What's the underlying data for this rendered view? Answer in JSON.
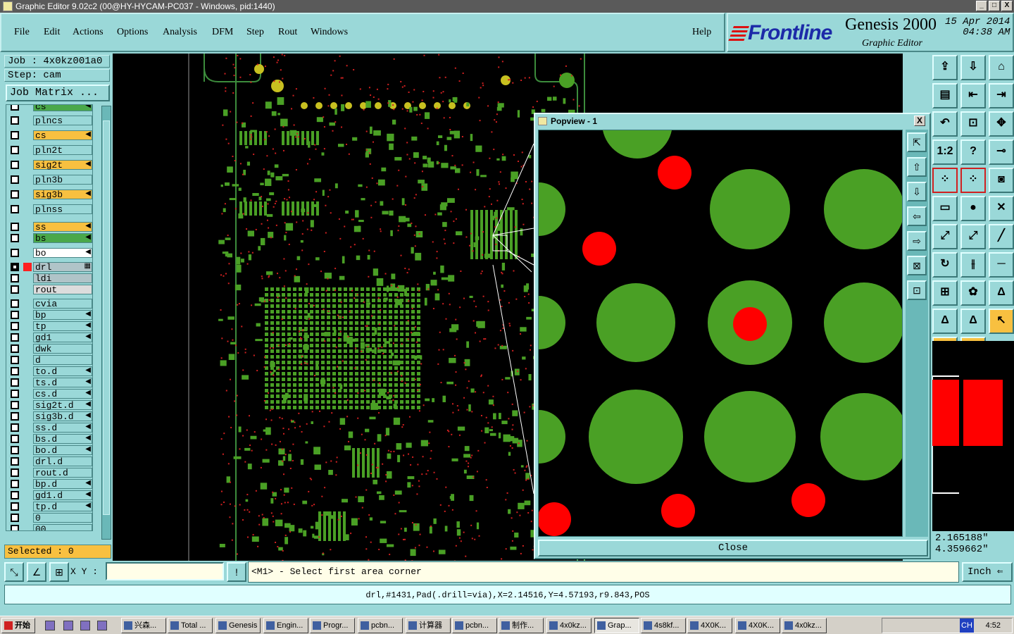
{
  "window": {
    "title": "Graphic Editor 9.02c2 (00@HY-HYCAM-PC037 - Windows, pid:1440)",
    "buttons": [
      "_",
      "□",
      "X"
    ]
  },
  "menu": {
    "items": [
      "File",
      "Edit",
      "Actions",
      "Options",
      "Analysis",
      "DFM",
      "Step",
      "Rout",
      "Windows"
    ],
    "help": "Help"
  },
  "brand": {
    "logo": "Frontline",
    "product": "Genesis 2000",
    "subtitle": "Graphic Editor",
    "date": "15 Apr 2014",
    "time": "04:38 AM"
  },
  "job": {
    "job_label": "Job : 4x0kz001a0",
    "step_label": "Step: cam",
    "matrix_button": "Job Matrix ..."
  },
  "layers": [
    {
      "name": "cs",
      "bg": "#4aa84a",
      "flag": "◀",
      "partial": true
    },
    {
      "name": "plncs",
      "bg": "#9ad8d8",
      "flag": ""
    },
    {
      "name": "cs",
      "bg": "#f8c040",
      "flag": "◀"
    },
    {
      "name": "pln2t",
      "bg": "#9ad8d8",
      "flag": ""
    },
    {
      "name": "sig2t",
      "bg": "#f8c040",
      "flag": "◀"
    },
    {
      "name": "pln3b",
      "bg": "#9ad8d8",
      "flag": ""
    },
    {
      "name": "sig3b",
      "bg": "#f8c040",
      "flag": "◀"
    },
    {
      "name": "plnss",
      "bg": "#9ad8d8",
      "flag": ""
    },
    {
      "name": "ss",
      "bg": "#f8c040",
      "flag": "◀"
    },
    {
      "name": "bs",
      "bg": "#4aa84a",
      "flag": "◀"
    },
    {
      "name": "bo",
      "bg": "#ffffff",
      "flag": "◀"
    },
    {
      "name": "drl",
      "bg": "#b0c4c8",
      "flag": "▦",
      "selected": true,
      "color": "#ff2020"
    },
    {
      "name": "ldi",
      "bg": "#b0c4c8",
      "flag": ""
    },
    {
      "name": "rout",
      "bg": "#dcdcdc",
      "flag": ""
    },
    {
      "name": "cvia",
      "bg": "#9ad8d8",
      "flag": ""
    },
    {
      "name": "bp",
      "bg": "#9ad8d8",
      "flag": "◀"
    },
    {
      "name": "tp",
      "bg": "#9ad8d8",
      "flag": "◀"
    },
    {
      "name": "gd1",
      "bg": "#9ad8d8",
      "flag": "◀"
    },
    {
      "name": "dwk",
      "bg": "#9ad8d8",
      "flag": ""
    },
    {
      "name": "d",
      "bg": "#9ad8d8",
      "flag": ""
    },
    {
      "name": "to.d",
      "bg": "#9ad8d8",
      "flag": "◀"
    },
    {
      "name": "ts.d",
      "bg": "#9ad8d8",
      "flag": "◀"
    },
    {
      "name": "cs.d",
      "bg": "#9ad8d8",
      "flag": "◀"
    },
    {
      "name": "sig2t.d",
      "bg": "#9ad8d8",
      "flag": "◀"
    },
    {
      "name": "sig3b.d",
      "bg": "#9ad8d8",
      "flag": "◀"
    },
    {
      "name": "ss.d",
      "bg": "#9ad8d8",
      "flag": "◀"
    },
    {
      "name": "bs.d",
      "bg": "#9ad8d8",
      "flag": "◀"
    },
    {
      "name": "bo.d",
      "bg": "#9ad8d8",
      "flag": "◀"
    },
    {
      "name": "drl.d",
      "bg": "#9ad8d8",
      "flag": ""
    },
    {
      "name": "rout.d",
      "bg": "#9ad8d8",
      "flag": ""
    },
    {
      "name": "bp.d",
      "bg": "#9ad8d8",
      "flag": "◀"
    },
    {
      "name": "gd1.d",
      "bg": "#9ad8d8",
      "flag": "◀"
    },
    {
      "name": "tp.d",
      "bg": "#9ad8d8",
      "flag": "◀"
    },
    {
      "name": "0",
      "bg": "#9ad8d8",
      "flag": ""
    },
    {
      "name": "00",
      "bg": "#9ad8d8",
      "flag": ""
    }
  ],
  "selected_count": "Selected : 0",
  "popview": {
    "title": "Popview - 1",
    "close_x": "X",
    "close_button": "Close",
    "tool_icons": [
      "zoom-fit-icon",
      "zoom-home-icon",
      "pan-down-icon",
      "pan-left-icon",
      "pan-right-icon",
      "zoom-out-icon",
      "zoom-in-icon"
    ]
  },
  "right_tools": {
    "labels": [
      "",
      "",
      "",
      "",
      "",
      "",
      "",
      "",
      "",
      "1:2",
      "?",
      "",
      "",
      "",
      "",
      "",
      "",
      "",
      "",
      "",
      "",
      "",
      "",
      "",
      "",
      "",
      "",
      "",
      "",
      "",
      ""
    ],
    "icons": [
      "import-icon",
      "export-icon",
      "home-icon",
      "frame-icon",
      "pan-left-icon",
      "pan-right-icon",
      "undo-icon",
      "step-icon",
      "fit-icon",
      "scale-icon",
      "help-icon",
      "measure-icon",
      "net-icon",
      "net2-icon",
      "select-icon",
      "ruler-icon",
      "pad-icon",
      "cross-icon",
      "line-add-icon",
      "line-del-icon",
      "draw-icon",
      "arc-icon",
      "text-icon",
      "cut-icon",
      "dim-icon",
      "shape-icon",
      "poly-icon",
      "poly2-icon",
      "poly3-icon",
      "pointer-icon",
      "pointer2-icon",
      "route-icon"
    ]
  },
  "coords": {
    "x": "2.165188\"",
    "y": "4.359662\""
  },
  "command": {
    "xy_label": "X Y :",
    "xy_value": "",
    "prompt": "<M1> - Select first area corner",
    "units": "Inch"
  },
  "status": "drl,#1431,Pad(.drill=via),X=2.14516,Y=4.57193,r9.843,POS",
  "taskbar": {
    "start": "开始",
    "tasks": [
      "兴森...",
      "Total ...",
      "Genesis",
      "Engin...",
      "Progr...",
      "pcbn...",
      "计算器",
      "pcbn...",
      "制作...",
      "4x0kz...",
      "Grap...",
      "4s8kf...",
      "4X0K...",
      "4X0K...",
      "4x0kz..."
    ],
    "active_index": 10,
    "tray_lang": "CH",
    "clock": "4:52"
  },
  "colors": {
    "panel": "#9ad8d8",
    "pad_green": "#4aa025",
    "drill_red": "#ff0000",
    "canvas": "#000000"
  }
}
